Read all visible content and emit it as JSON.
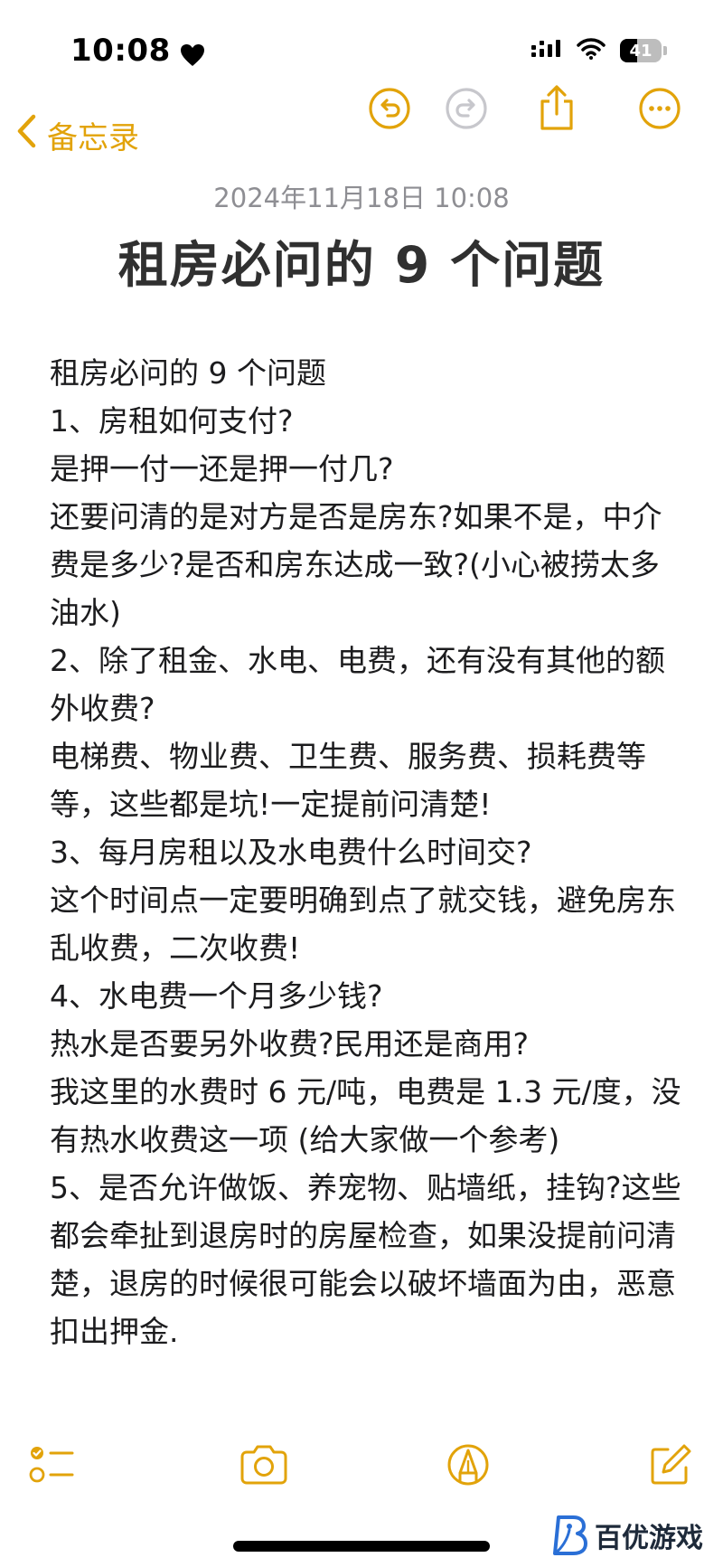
{
  "status_bar": {
    "time": "10:08",
    "battery_level": "41",
    "battery_fraction": 0.41
  },
  "nav": {
    "back_label": "备忘录",
    "accent_color": "#e2a30a",
    "icons": [
      "chevron-left-icon",
      "undo-icon",
      "redo-icon",
      "share-icon",
      "more-icon"
    ]
  },
  "note": {
    "date": "2024年11月18日 10:08",
    "title": "租房必问的 9 个问题",
    "lines": [
      "租房必问的 9 个问题",
      "1、房租如何支付?",
      "是押一付一还是押一付几?",
      "还要问清的是对方是否是房东?如果不是，中介费是多少?是否和房东达成一致?(小心被捞太多油水)",
      "2、除了租金、水电、电费，还有没有其他的额外收费?",
      "电梯费、物业费、卫生费、服务费、损耗费等等，这些都是坑!一定提前问清楚!",
      "3、每月房租以及水电费什么时间交?",
      "这个时间点一定要明确到点了就交钱，避免房东乱收费，二次收费!",
      "4、水电费一个月多少钱?",
      "热水是否要另外收费?民用还是商用?",
      "我这里的水费时 6 元/吨，电费是 1.3 元/度，没有热水收费这一项 (给大家做一个参考)",
      "5、是否允许做饭、养宠物、贴墙纸，挂钩?这些都会牵扯到退房时的房屋检查，如果没提前问清楚，退房的时候很可能会以破坏墙面为由，恶意扣出押金."
    ]
  },
  "toolbar": {
    "icons": [
      "checklist-icon",
      "camera-icon",
      "markup-icon",
      "compose-icon"
    ]
  },
  "watermark": {
    "text": "百优游戏"
  }
}
